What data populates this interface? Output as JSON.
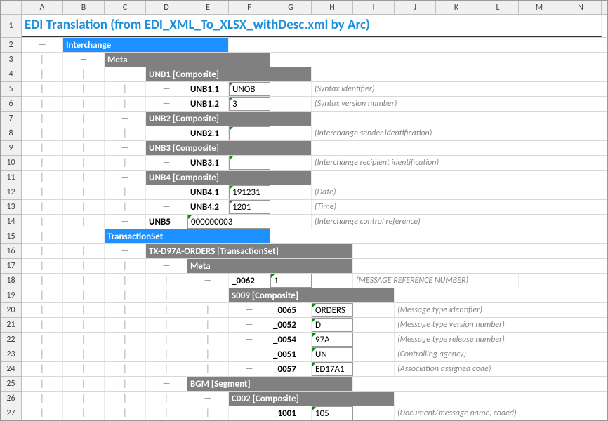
{
  "columns": [
    "A",
    "B",
    "C",
    "D",
    "E",
    "F",
    "G",
    "H",
    "I",
    "J",
    "K",
    "L",
    "M",
    "N"
  ],
  "title": "EDI Translation (from EDI_XML_To_XLSX_withDesc.xml by Arc)",
  "tree": {
    "pipe": "│",
    "dash": "—"
  },
  "hdr": {
    "interchange": "Interchange",
    "meta": "Meta",
    "unb1": "UNB1 [Composite]",
    "unb2": "UNB2 [Composite]",
    "unb3": "UNB3 [Composite]",
    "unb4": "UNB4 [Composite]",
    "txset": "TransactionSet",
    "txorders": "TX-D97A-ORDERS [TransactionSet]",
    "meta2": "Meta",
    "s009": "S009 [Composite]",
    "bgm": "BGM [Segment]",
    "c002": "C002 [Composite]"
  },
  "fld": {
    "unb11": "UNB1.1",
    "unb12": "UNB1.2",
    "unb21": "UNB2.1",
    "unb31": "UNB3.1",
    "unb41": "UNB4.1",
    "unb42": "UNB4.2",
    "unb5": "UNB5",
    "f0062": "_0062",
    "f0065": "_0065",
    "f0052": "_0052",
    "f0054": "_0054",
    "f0051": "_0051",
    "f0057": "_0057",
    "f1001": "_1001"
  },
  "val": {
    "unob": "UNOB",
    "three": "3",
    "date": "191231",
    "time": "1201",
    "ctrl": "000000003",
    "one": "1",
    "orders": "ORDERS",
    "d": "D",
    "r97a": "97A",
    "un": "UN",
    "ed17a1": "ED17A1",
    "v105": "105"
  },
  "desc": {
    "syntaxid": "(Syntax identifier)",
    "syntaxver": "(Syntax version number)",
    "senderid": "(Interchange sender identification)",
    "recipid": "(Interchange recipient identification)",
    "date": "(Date)",
    "time": "(Time)",
    "ctrlref": "(Interchange control reference)",
    "msgref": "(MESSAGE REFERENCE NUMBER)",
    "msgtypeid": "(Message type identifier)",
    "msgtypever": "(Message type version number)",
    "msgtyperel": "(Message type release number)",
    "ctrlagency": "(Controlling agency)",
    "assoccode": "(Association assigned code)",
    "docname": "(Document/message name, coded)"
  }
}
